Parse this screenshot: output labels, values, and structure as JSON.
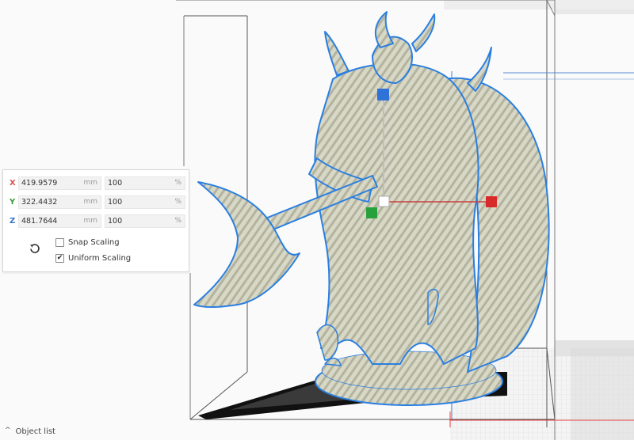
{
  "scale": {
    "x": {
      "label": "X",
      "mm": "419.9579",
      "mm_unit": "mm",
      "pct": "100",
      "pct_unit": "%"
    },
    "y": {
      "label": "Y",
      "mm": "322.4432",
      "mm_unit": "mm",
      "pct": "100",
      "pct_unit": "%"
    },
    "z": {
      "label": "Z",
      "mm": "481.7644",
      "mm_unit": "mm",
      "pct": "100",
      "pct_unit": "%"
    },
    "snap_scaling": {
      "label": "Snap Scaling",
      "checked": false
    },
    "uniform_scaling": {
      "label": "Uniform Scaling",
      "checked": true
    },
    "reset_icon": "undo-icon"
  },
  "footer": {
    "object_list_label": "Object list",
    "chevron_icon": "chevron-up-icon"
  },
  "colors": {
    "axis_x": "#d9534f",
    "axis_y": "#3a9d3a",
    "axis_z": "#3a73c9",
    "model": "#d4d4c0",
    "outline": "#2a7fe0"
  }
}
